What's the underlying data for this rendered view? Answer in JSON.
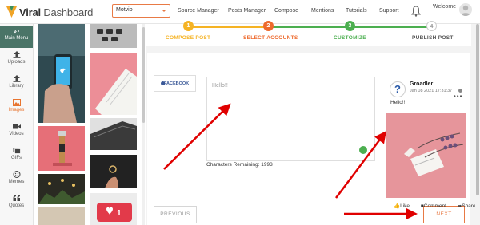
{
  "brand": {
    "name_bold": "Viral",
    "name_rest": " Dashboard",
    "accent": "#f0a427"
  },
  "header": {
    "account_select": "Motvio",
    "nav": [
      "Source Manager",
      "Posts Manager",
      "Compose",
      "Mentions",
      "Tutorials",
      "Support"
    ],
    "welcome": "Welcome",
    "bell_icon": "bell-icon"
  },
  "sidebar": {
    "main_menu": "Main Menu",
    "items": [
      {
        "label": "Uploads",
        "icon": "upload-icon"
      },
      {
        "label": "Library",
        "icon": "upload-icon"
      },
      {
        "label": "Images",
        "icon": "image-icon",
        "active": true
      },
      {
        "label": "Videos",
        "icon": "video-icon"
      },
      {
        "label": "GIFs",
        "icon": "gif-icon"
      },
      {
        "label": "Memes",
        "icon": "meme-icon"
      },
      {
        "label": "Quotes",
        "icon": "quote-icon"
      }
    ]
  },
  "steps": [
    {
      "num": "1",
      "label": "COMPOSE POST",
      "color": "#f5b324"
    },
    {
      "num": "2",
      "label": "SELECT ACCOUNTS",
      "color": "#ee6a2d"
    },
    {
      "num": "3",
      "label": "CUSTOMIZE",
      "color": "#4caf50"
    },
    {
      "num": "4",
      "label": "PUBLISH POST",
      "color": "#cfcfcf"
    }
  ],
  "composer": {
    "network_tab": "FACEBOOK",
    "text": "Hello!!",
    "chars_label": "Characters Remaining: 1993",
    "prev_label": "PREVIOUS",
    "next_label": "NEXT"
  },
  "preview": {
    "name": "Groadler",
    "time": "Jan 08 2021 17:31:37",
    "text": "Hello!!",
    "actions": [
      "Like",
      "Comment",
      "Share"
    ]
  },
  "colors": {
    "accent": "#e87a45",
    "sidebar_dark": "#4a7467",
    "arrow": "#e00000"
  }
}
